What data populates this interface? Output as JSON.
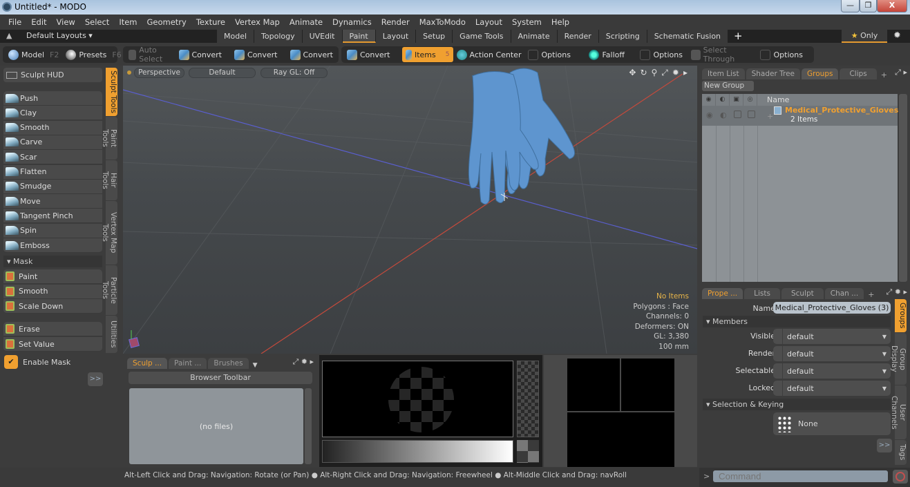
{
  "window": {
    "title": "Untitled* - MODO",
    "minimize": "—",
    "restore": "❐",
    "close": "X"
  },
  "menu": [
    "File",
    "Edit",
    "View",
    "Select",
    "Item",
    "Geometry",
    "Texture",
    "Vertex Map",
    "Animate",
    "Dynamics",
    "Render",
    "MaxToModo",
    "Layout",
    "System",
    "Help"
  ],
  "layoutbar": {
    "layouts_label": "Default Layouts ▾",
    "tabs": [
      "Model",
      "Topology",
      "UVEdit",
      "Paint",
      "Layout",
      "Setup",
      "Game Tools",
      "Animate",
      "Render",
      "Scripting",
      "Schematic Fusion"
    ],
    "active_tab": "Paint",
    "add": "+",
    "only_label": "Only",
    "star": "★"
  },
  "toolbar": {
    "model": "Model",
    "model_key": "F2",
    "presets": "Presets",
    "presets_key": "F6",
    "auto_select": "Auto Select",
    "convert": "Convert",
    "items": "Items",
    "items_key": "5",
    "action_center": "Action Center",
    "options": "Options",
    "falloff": "Falloff",
    "select_through": "Select Through"
  },
  "leftpanel": {
    "sculpt_hud": "Sculpt HUD",
    "tools": [
      "Push",
      "Clay",
      "Smooth",
      "Carve",
      "Scar",
      "Flatten",
      "Smudge",
      "Move",
      "Tangent Pinch",
      "Spin",
      "Emboss"
    ],
    "mask_header": "Mask",
    "mask_tools": [
      "Paint",
      "Smooth",
      "Scale Down"
    ],
    "mask_tools2": [
      "Erase",
      "Set Value"
    ],
    "enable_mask": "Enable Mask",
    "enable_mask_checked": true,
    "more": ">>",
    "vtabs": [
      "Sculpt Tools",
      "Paint Tools",
      "Hair Tools",
      "Vertex Map Tools",
      "Particle Tools",
      "Utilities"
    ]
  },
  "viewport": {
    "view": "Perspective",
    "shading": "Default",
    "raygl": "Ray GL: Off",
    "info": {
      "items": "No Items",
      "polygons": "Polygons : Face",
      "channels": "Channels: 0",
      "deformers": "Deformers: ON",
      "gl": "GL: 3,380",
      "unit": "100 mm"
    }
  },
  "browser": {
    "tabs": [
      "Sculp ...",
      "Paint ...",
      "Brushes"
    ],
    "toolbar": "Browser Toolbar",
    "empty": "(no files)"
  },
  "groups_panel": {
    "tabs": [
      "Item List",
      "Shader Tree",
      "Groups",
      "Clips"
    ],
    "active_tab": "Groups",
    "new_group": "New Group",
    "col_name": "Name",
    "group_name": "Medical_Protective_Gloves...",
    "group_count": "2 Items"
  },
  "properties": {
    "tabs": [
      "Prope ...",
      "Lists",
      "Sculpt",
      "Chan ..."
    ],
    "name_label": "Name",
    "name_value": "Medical_Protective_Gloves (3)",
    "members_header": "Members",
    "fields": [
      {
        "label": "Visible",
        "value": "default"
      },
      {
        "label": "Render",
        "value": "default"
      },
      {
        "label": "Selectable",
        "value": "default"
      },
      {
        "label": "Locked",
        "value": "default"
      }
    ],
    "sel_header": "Selection & Keying",
    "sel_value": "None",
    "more": ">>",
    "vtabs": [
      "Groups",
      "Group Display",
      "User Channels",
      "Tags"
    ]
  },
  "command": {
    "prompt": ">",
    "placeholder": "Command"
  },
  "status": "Alt-Left Click and Drag: Navigation: Rotate (or Pan) ● Alt-Right Click and Drag: Navigation: Freewheel ● Alt-Middle Click and Drag: navRoll"
}
